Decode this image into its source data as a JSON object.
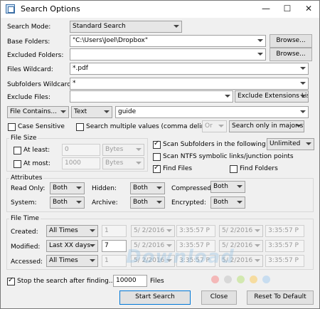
{
  "window": {
    "title": "Search Options",
    "minimize": "—",
    "maximize": "☐",
    "close": "✕"
  },
  "search_mode": {
    "label": "Search Mode:",
    "value": "Standard Search"
  },
  "base_folders": {
    "label": "Base Folders:",
    "value": "\"C:\\Users\\Joel\\Dropbox\"",
    "browse": "Browse..."
  },
  "excluded_folders": {
    "label": "Excluded Folders:",
    "value": "",
    "browse": "Browse..."
  },
  "files_wildcard": {
    "label": "Files Wildcard:",
    "value": "*.pdf"
  },
  "subfolders_wildcard": {
    "label": "Subfolders Wildcard:",
    "value": "*"
  },
  "exclude_files": {
    "label": "Exclude Files:",
    "value": "",
    "mode": "Exclude Extensions List"
  },
  "content": {
    "mode": "File Contains...",
    "type": "Text",
    "value": "guide"
  },
  "options": {
    "case_sensitive": "Case Sensitive",
    "search_multiple": "Search multiple values (comma delimited)",
    "or_value": "Or",
    "stream_value": "Search only in major stre"
  },
  "file_size": {
    "title": "File Size",
    "at_least": "At least:",
    "at_least_value": "0",
    "at_least_unit": "Bytes",
    "at_most": "At most:",
    "at_most_value": "1000",
    "at_most_unit": "Bytes"
  },
  "scan": {
    "subfolders": "Scan Subfolders in the following depth:",
    "depth": "Unlimited",
    "ntfs": "Scan NTFS symbolic links/junction points",
    "find_files": "Find Files",
    "find_folders": "Find Folders"
  },
  "attributes": {
    "title": "Attributes",
    "read_only": "Read Only:",
    "read_only_value": "Both",
    "hidden": "Hidden:",
    "hidden_value": "Both",
    "compressed": "Compressed:",
    "compressed_value": "Both",
    "system": "System:",
    "system_value": "Both",
    "archive": "Archive:",
    "archive_value": "Both",
    "encrypted": "Encrypted:",
    "encrypted_value": "Both"
  },
  "file_time": {
    "title": "File Time",
    "rows": [
      {
        "label": "Created:",
        "mode": "All Times",
        "num": "1",
        "d1": "5/  2/2016",
        "t1": "3:35:57 P",
        "d2": "5/  2/2016",
        "t2": "3:35:57 P"
      },
      {
        "label": "Modified:",
        "mode": "Last XX days",
        "num": "7",
        "d1": "5/  2/2016",
        "t1": "3:35:57 P",
        "d2": "5/  2/2016",
        "t2": "3:35:57 P"
      },
      {
        "label": "Accessed:",
        "mode": "All Times",
        "num": "1",
        "d1": "5/  2/2016",
        "t1": "3:35:57 P",
        "d2": "5/  2/2016",
        "t2": "3:35:57 P"
      }
    ]
  },
  "stop": {
    "label": "Stop the search after finding...",
    "value": "10000",
    "suffix": "Files"
  },
  "buttons": {
    "start": "Start Search",
    "close": "Close",
    "reset": "Reset To Default"
  },
  "watermark": "Download"
}
